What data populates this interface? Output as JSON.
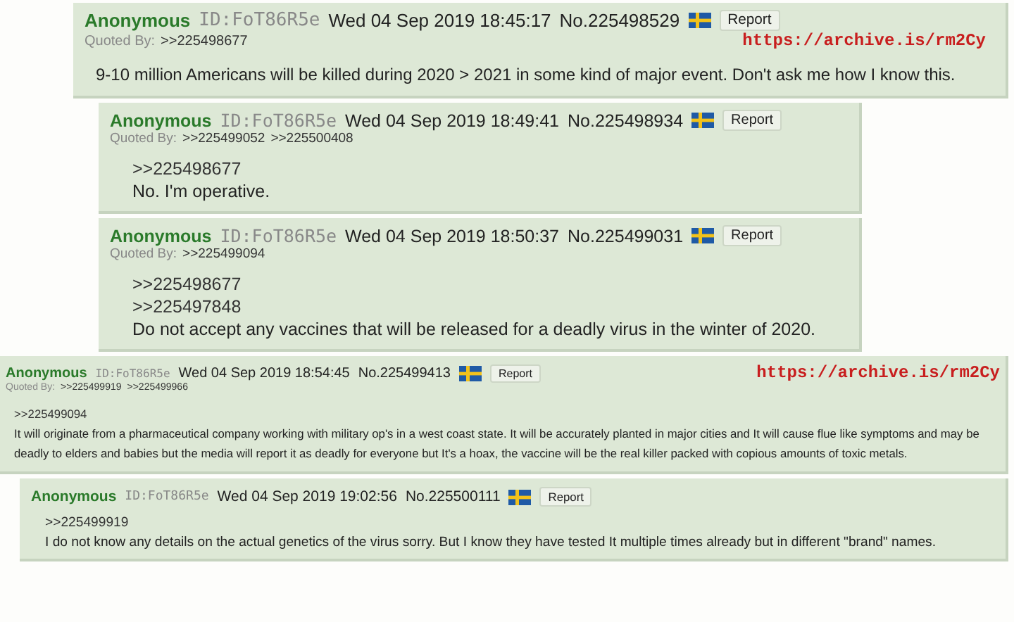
{
  "posts": [
    {
      "name": "Anonymous",
      "id": "ID:FoT86R5e",
      "datetime": "Wed 04 Sep 2019 18:45:17",
      "number": "No.225498529",
      "report": "Report",
      "quoted_by_label": "Quoted By:",
      "quoted_by": [
        ">>225498677"
      ],
      "archive_link": "https://archive.is/rm2Cy",
      "message": "9-10 million Americans will be killed during 2020 > 2021 in some kind of major event. Don't ask me how I know this."
    },
    {
      "name": "Anonymous",
      "id": "ID:FoT86R5e",
      "datetime": "Wed 04 Sep 2019 18:49:41",
      "number": "No.225498934",
      "report": "Report",
      "quoted_by_label": "Quoted By:",
      "quoted_by": [
        ">>225499052",
        ">>225500408"
      ],
      "quotes": [
        ">>225498677"
      ],
      "message": "No. I'm operative."
    },
    {
      "name": "Anonymous",
      "id": "ID:FoT86R5e",
      "datetime": "Wed 04 Sep 2019 18:50:37",
      "number": "No.225499031",
      "report": "Report",
      "quoted_by_label": "Quoted By:",
      "quoted_by": [
        ">>225499094"
      ],
      "quotes": [
        ">>225498677",
        ">>225497848"
      ],
      "message": "Do not accept any vaccines that will be released for a deadly virus in the winter of 2020."
    },
    {
      "name": "Anonymous",
      "id": "ID:FoT86R5e",
      "datetime": "Wed 04 Sep 2019 18:54:45",
      "number": "No.225499413",
      "report": "Report",
      "quoted_by_label": "Quoted By:",
      "quoted_by": [
        ">>225499919",
        ">>225499966"
      ],
      "archive_link": "https://archive.is/rm2Cy",
      "quotes": [
        ">>225499094"
      ],
      "message": "It will originate from a pharmaceutical company working with military op's in a west coast state. It will be accurately planted in major cities and It will cause flue like symptoms and may be deadly to elders and babies but the media will report it as deadly for everyone but It's a hoax, the vaccine will be the real killer packed with copious amounts of toxic metals."
    },
    {
      "name": "Anonymous",
      "id": "ID:FoT86R5e",
      "datetime": "Wed 04 Sep 2019 19:02:56",
      "number": "No.225500111",
      "report": "Report",
      "quotes": [
        ">>225499919"
      ],
      "message": "I do not know any details on the actual genetics of the virus sorry. But I know they have tested It multiple times already but in different \"brand\" names."
    }
  ]
}
